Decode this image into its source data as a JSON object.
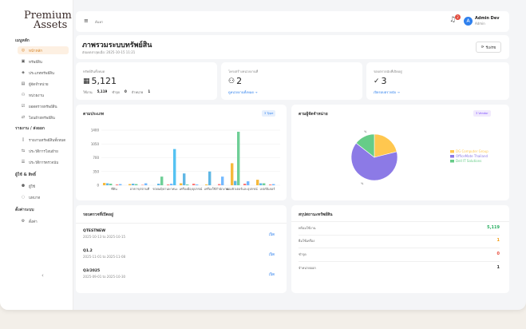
{
  "brand": {
    "line1": "Premium",
    "line2": "Assets"
  },
  "sidebar": {
    "sections": [
      {
        "label": "เมนูหลัก",
        "items": [
          {
            "label": "หน้าหลัก",
            "icon": "dashboard-icon",
            "active": true
          },
          {
            "label": "ทรัพย์สิน",
            "icon": "box-icon"
          },
          {
            "label": "ประเภททรัพย์สิน",
            "icon": "tag-icon"
          },
          {
            "label": "ผู้จัดจำหน่าย",
            "icon": "building-icon"
          },
          {
            "label": "หน่วยงาน",
            "icon": "org-icon"
          },
          {
            "label": "ยอดตรวจทรัพย์สิน",
            "icon": "check-icon"
          },
          {
            "label": "โอนย้ายทรัพย์สิน",
            "icon": "transfer-icon"
          }
        ]
      },
      {
        "label": "รายงาน / ส่งออก",
        "items": [
          {
            "label": "รายงานทรัพย์สินทั้งหมด",
            "icon": "report-icon"
          },
          {
            "label": "ประวัติการโอนย้าย",
            "icon": "history-icon"
          },
          {
            "label": "ประวัติการตรวจนับ",
            "icon": "list-icon"
          }
        ]
      },
      {
        "label": "ผู้ใช้ & สิทธิ์",
        "items": [
          {
            "label": "ผู้ใช้",
            "icon": "user-icon"
          },
          {
            "label": "บทบาท",
            "icon": "role-icon"
          }
        ]
      },
      {
        "label": "ตั้งค่าระบบ",
        "items": [
          {
            "label": "ตั้งค่า",
            "icon": "gear-icon"
          }
        ]
      }
    ],
    "collapse_glyph": "‹"
  },
  "topbar": {
    "search_text": "ค้นหา",
    "notification_count": "2",
    "user_initial": "A",
    "user_name": "Admin Dev",
    "user_role": "Admin"
  },
  "header": {
    "title": "ภาพรวมระบบทรัพย์สิน",
    "subtitle": "อัปเดตล่าสุดเมื่อ: 2025-10-15 11:21",
    "refresh_label": "รีเฟรช"
  },
  "stats": [
    {
      "label": "ทรัพย์สินทั้งหมด",
      "value": "5,121",
      "icon": "grid-icon",
      "detail": [
        {
          "k": "ใช้งาน",
          "v": "5,119"
        },
        {
          "k": "ชำรุด",
          "v": "0"
        },
        {
          "k": "จำหน่าย",
          "v": "1"
        }
      ]
    },
    {
      "label": "โครงสร้างหน่วยงานที่",
      "value": "2",
      "icon": "org-icon",
      "link": "ดูหน่วยงานทั้งหมด →"
    },
    {
      "label": "รอบตรวจนับที่เปิดอยู่",
      "value": "3",
      "icon": "check-circle-icon",
      "link": "เปิดรอบตรวจนับ →"
    }
  ],
  "charts": {
    "type_title": "ตามประเภท",
    "type_tag": "3 Type",
    "vendor_title": "ตามผู้จัดจำหน่าย",
    "vendor_tag": "3 Vendor"
  },
  "chart_data": [
    {
      "type": "bar",
      "categories": [
        "ที่ดิน",
        "อาคาร/สถานที่",
        "รถยนต์/ยานพาหนะ",
        "เครื่องมือ/อุปกรณ์",
        "เครื่องใช้สำนักงาน",
        "คอมพิวเตอร์และอุปกรณ์",
        "เฟอร์นิเจอร์"
      ],
      "series": [
        {
          "values": [
            60,
            30,
            0,
            50,
            20,
            560,
            140
          ],
          "color": "#f6b93b"
        },
        {
          "values": [
            50,
            40,
            40,
            300,
            350,
            110,
            50
          ],
          "color": "#5fb7e5"
        },
        {
          "values": [
            40,
            30,
            220,
            20,
            0,
            1360,
            50
          ],
          "color": "#6fcf97"
        },
        {
          "values": [
            0,
            0,
            0,
            0,
            0,
            0,
            0
          ],
          "color": "#a29bfe"
        },
        {
          "values": [
            20,
            10,
            20,
            40,
            30,
            40,
            20
          ],
          "color": "#ff7675"
        },
        {
          "values": [
            30,
            50,
            40,
            20,
            220,
            100,
            30
          ],
          "color": "#74b9ff"
        },
        {
          "values": [
            0,
            0,
            920,
            0,
            0,
            0,
            0
          ],
          "color": "#55c2f2"
        }
      ],
      "yticks": [
        "0",
        "350",
        "700",
        "1050",
        "1400"
      ],
      "ylim": [
        0,
        1400
      ]
    },
    {
      "type": "pie",
      "series": [
        {
          "name": "DG Computer Group",
          "value": 1080,
          "color": "#ffc74f"
        },
        {
          "name": "OfficeMate Thailand",
          "value": 3300,
          "color": "#8c7ae6"
        },
        {
          "name": "Dell IT Solutions",
          "value": 740,
          "color": "#66cc88"
        }
      ],
      "slice_labels": [
        "%",
        "%"
      ]
    }
  ],
  "inspections": {
    "title": "รอบตรวจที่เปิดอยู่",
    "items": [
      {
        "name": "QTESTNEW",
        "dates": "2025-10-13 to 2025-10-15",
        "action": "เปิด"
      },
      {
        "name": "Q1.2",
        "dates": "2025-11-01 to 2025-11-08",
        "action": "เปิด"
      },
      {
        "name": "Q3/2025",
        "dates": "2025-09-01 to 2025-10-30",
        "action": "เปิด"
      }
    ]
  },
  "summary": {
    "title": "สรุปสถานะทรัพย์สิน",
    "rows": [
      {
        "k": "พร้อมใช้งาน",
        "v": "5,119",
        "color": "#27ae60"
      },
      {
        "k": "ยืมใช้เครื่อง",
        "v": "1",
        "color": "#f39c12"
      },
      {
        "k": "ชำรุด",
        "v": "0",
        "color": "#e74c3c"
      },
      {
        "k": "จำหน่ายออก",
        "v": "1",
        "color": "#333333"
      }
    ]
  }
}
